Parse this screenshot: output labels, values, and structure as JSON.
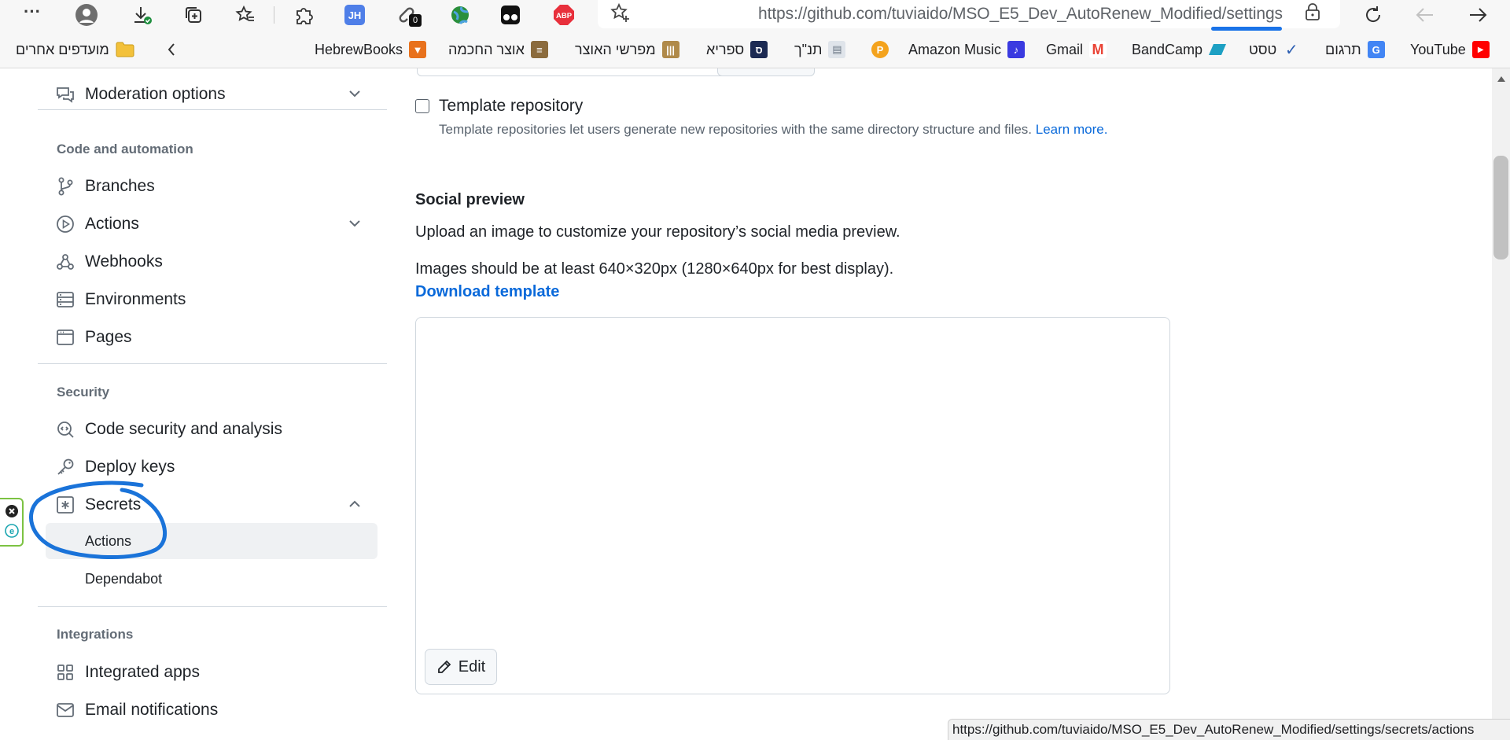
{
  "browser": {
    "url": "https://github.com/tuviaido/MSO_E5_Dev_AutoRenew_Modified/settings",
    "more_label": "···",
    "extension_badge": "0",
    "abp_label": "ABP",
    "jh_label": "JH"
  },
  "bookmarks": {
    "other_favorites": "מועדפים אחרים",
    "items": [
      {
        "label": "HebrewBooks",
        "color": "#e8711c"
      },
      {
        "label": "אוצר החכמה",
        "color": "#8b6b3d"
      },
      {
        "label": "מפרשי האוצר",
        "color": "#b08a4a"
      },
      {
        "label": "ספריא",
        "color": "#1c2a53"
      },
      {
        "label": "תנ\"ך",
        "color": "#9aa6b2"
      },
      {
        "label": "",
        "color": "#f4a31d"
      },
      {
        "label": "Amazon Music",
        "color": "#3a3ae0"
      },
      {
        "label": "Gmail",
        "color": "#ea4335"
      },
      {
        "label": "BandCamp",
        "color": "#1da0c3"
      },
      {
        "label": "טסט",
        "color": "#2d5fb2"
      },
      {
        "label": "תרגום",
        "color": "#4285f4"
      },
      {
        "label": "YouTube",
        "color": "#ff0000"
      }
    ]
  },
  "sidebar": {
    "moderation": "Moderation options",
    "code_automation_heading": "Code and automation",
    "branches": "Branches",
    "actions": "Actions",
    "webhooks": "Webhooks",
    "environments": "Environments",
    "pages": "Pages",
    "security_heading": "Security",
    "code_security": "Code security and analysis",
    "deploy_keys": "Deploy keys",
    "secrets": "Secrets",
    "secrets_actions": "Actions",
    "secrets_dependabot": "Dependabot",
    "integrations_heading": "Integrations",
    "integrated_apps": "Integrated apps",
    "email_notifications": "Email notifications"
  },
  "main": {
    "template_repo_title": "Template repository",
    "template_repo_desc": "Template repositories let users generate new repositories with the same directory structure and files.",
    "learn_more": "Learn more.",
    "social_preview_title": "Social preview",
    "social_preview_desc": "Upload an image to customize your repository’s social media preview.",
    "image_requirements": "Images should be at least 640×320px (1280×640px for best display).",
    "download_template": "Download template",
    "edit_label": "Edit"
  },
  "status_bar": {
    "url": "https://github.com/tuviaido/MSO_E5_Dev_AutoRenew_Modified/settings/secrets/actions"
  },
  "annotation": {
    "color": "#1a73d9"
  }
}
